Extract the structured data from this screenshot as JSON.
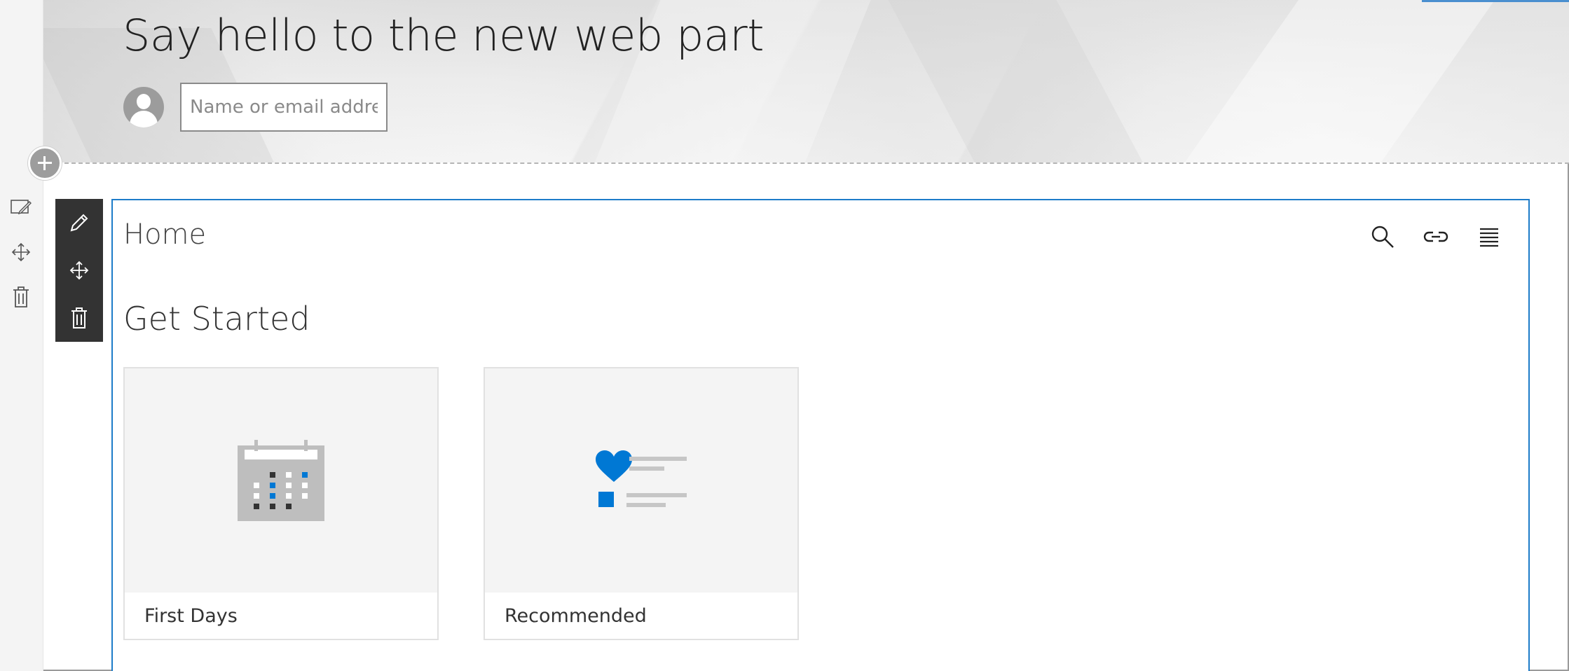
{
  "page": {
    "title": "Say hello to the new web part"
  },
  "author": {
    "placeholder": "Name or email address"
  },
  "webpart": {
    "nav_title": "Home",
    "section_heading": "Get Started",
    "cards": [
      {
        "label": "First Days",
        "icon": "calendar-icon"
      },
      {
        "label": "Recommended",
        "icon": "heart-list-icon"
      }
    ]
  },
  "colors": {
    "accent": "#1d7cc9",
    "toolbar": "#333333",
    "icon_blue": "#0078d4"
  }
}
